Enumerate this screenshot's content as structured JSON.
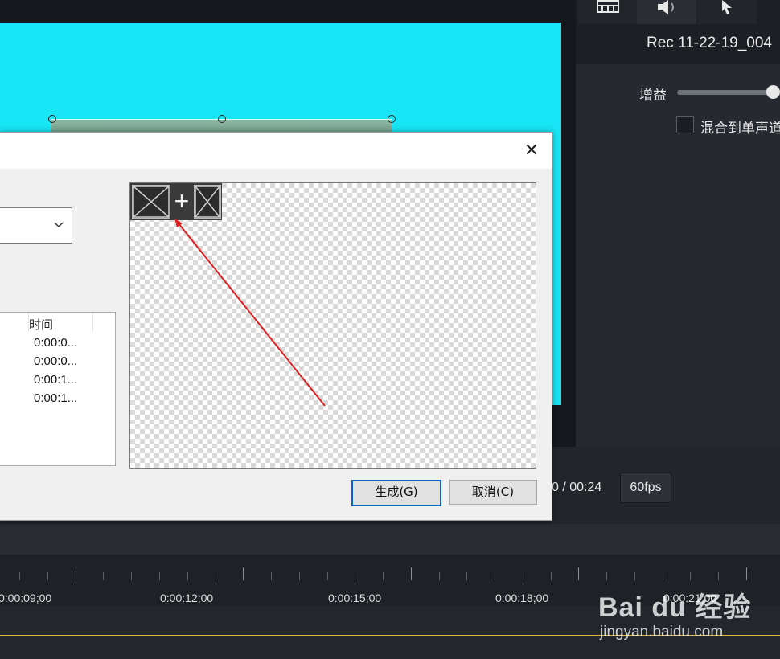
{
  "properties_panel": {
    "tabs": [
      {
        "name": "visual-tab",
        "icon": "film-icon"
      },
      {
        "name": "audio-tab",
        "icon": "speaker-icon",
        "active": true
      },
      {
        "name": "cursor-tab",
        "icon": "cursor-icon"
      }
    ],
    "title": "Rec 11-22-19_004",
    "gain_label": "增益",
    "gain_level_percent": 100,
    "mix_mono_label": "混合到单声道",
    "accent_color": "#8fbf2a"
  },
  "player": {
    "time": "0 / 00:24",
    "fps": "60fps"
  },
  "timeline": {
    "labels": [
      "0:00:09;00",
      "0:00:12;00",
      "0:00:15;00",
      "0:00:18;00",
      "0:00:21;00"
    ],
    "playhead_color": "#e7b33c"
  },
  "dialog": {
    "list_header": "时间",
    "list_rows": [
      "0:00:0...",
      "0:00:0...",
      "0:00:1...",
      "0:00:1..."
    ],
    "generate_label": "生成(G)",
    "cancel_label": "取消(C)",
    "close_glyph": "✕",
    "plus_glyph": "+"
  },
  "watermark": {
    "logo": "Bai du 经验",
    "url": "jingyan.baidu.com"
  },
  "colors": {
    "canvas": "#18e5f5",
    "dialog_bg": "#f0f0f0",
    "arrow": "#e02020"
  }
}
